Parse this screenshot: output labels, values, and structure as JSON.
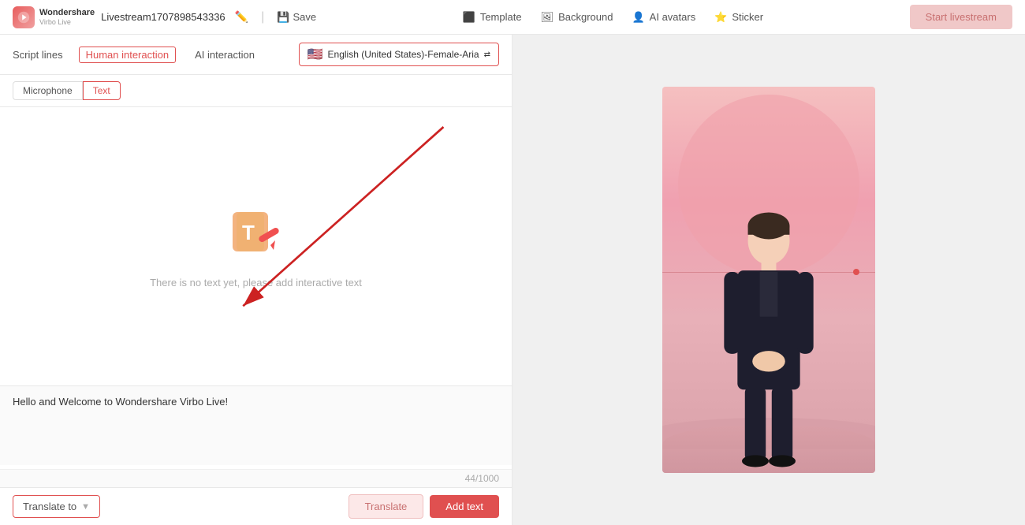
{
  "header": {
    "logo_name": "Wondershare",
    "logo_sub": "Virbo Live",
    "stream_title": "Livestream1707898543336",
    "save_label": "Save",
    "nav": [
      {
        "label": "Template",
        "icon": "template-icon"
      },
      {
        "label": "Background",
        "icon": "background-icon"
      },
      {
        "label": "AI avatars",
        "icon": "ai-avatars-icon"
      },
      {
        "label": "Sticker",
        "icon": "sticker-icon"
      }
    ],
    "start_btn": "Start livestream"
  },
  "left_panel": {
    "script_lines_label": "Script lines",
    "tabs": [
      {
        "label": "Human interaction",
        "active": true
      },
      {
        "label": "AI interaction",
        "active": false
      }
    ],
    "language": "English (United States)-Female-Aria",
    "input_types": [
      {
        "label": "Microphone",
        "active": false
      },
      {
        "label": "Text",
        "active": true
      }
    ],
    "empty_state_text": "There is no text yet, please add interactive text",
    "text_input_value": "Hello and Welcome to Wondershare Virbo Live!",
    "char_count": "44/1000",
    "bottom": {
      "translate_to_label": "Translate to",
      "translate_btn": "Translate",
      "add_text_btn": "Add text"
    }
  }
}
